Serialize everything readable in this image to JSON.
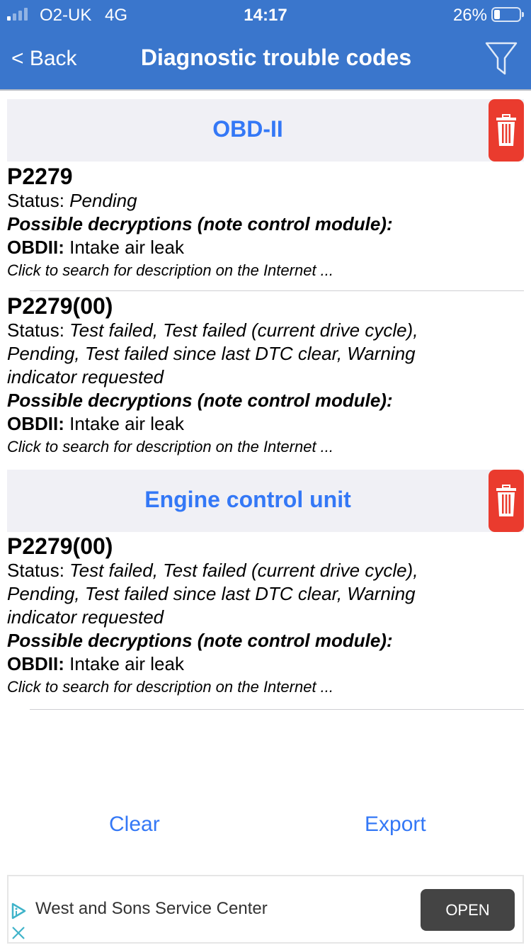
{
  "status_bar": {
    "carrier": "O2-UK",
    "network": "4G",
    "time": "14:17",
    "battery": "26%",
    "battery_level": 0.26,
    "signal_bars": 1
  },
  "nav": {
    "back_label": "< Back",
    "title": "Diagnostic trouble codes",
    "filter_icon": "filter-icon"
  },
  "sections": [
    {
      "title": "OBD-II",
      "delete_icon": "trash-icon",
      "items": [
        {
          "code": "P2279",
          "status_label": "Status: ",
          "status_lines": [
            "Pending"
          ],
          "decryptions_heading": "Possible decryptions (note control module):",
          "module_label": "OBDII:",
          "description": " Intake air leak",
          "search_hint": "Click to search for description on the Internet ..."
        },
        {
          "code": "P2279(00)",
          "status_label": "Status: ",
          "status_lines": [
            "Test failed, Test failed (current drive cycle),",
            "Pending, Test failed since last DTC clear, Warning",
            "indicator requested"
          ],
          "decryptions_heading": "Possible decryptions (note control module):",
          "module_label": "OBDII:",
          "description": " Intake air leak",
          "search_hint": "Click to search for description on the Internet ..."
        }
      ]
    },
    {
      "title": "Engine control unit",
      "delete_icon": "trash-icon",
      "items": [
        {
          "code": "P2279(00)",
          "status_label": "Status: ",
          "status_lines": [
            "Test failed, Test failed (current drive cycle),",
            "Pending, Test failed since last DTC clear, Warning",
            "indicator requested"
          ],
          "decryptions_heading": "Possible decryptions (note control module):",
          "module_label": "OBDII:",
          "description": " Intake air leak",
          "search_hint": "Click to search for description on the Internet ..."
        }
      ]
    }
  ],
  "actions": {
    "clear_label": "Clear",
    "export_label": "Export"
  },
  "ad": {
    "text": "West and Sons Service Center",
    "button_label": "OPEN"
  },
  "colors": {
    "nav_bar": "#3a76cc",
    "accent": "#3478f6",
    "delete": "#ea3b2e",
    "section_bg": "#f0f0f5",
    "ad_button": "#444444"
  }
}
